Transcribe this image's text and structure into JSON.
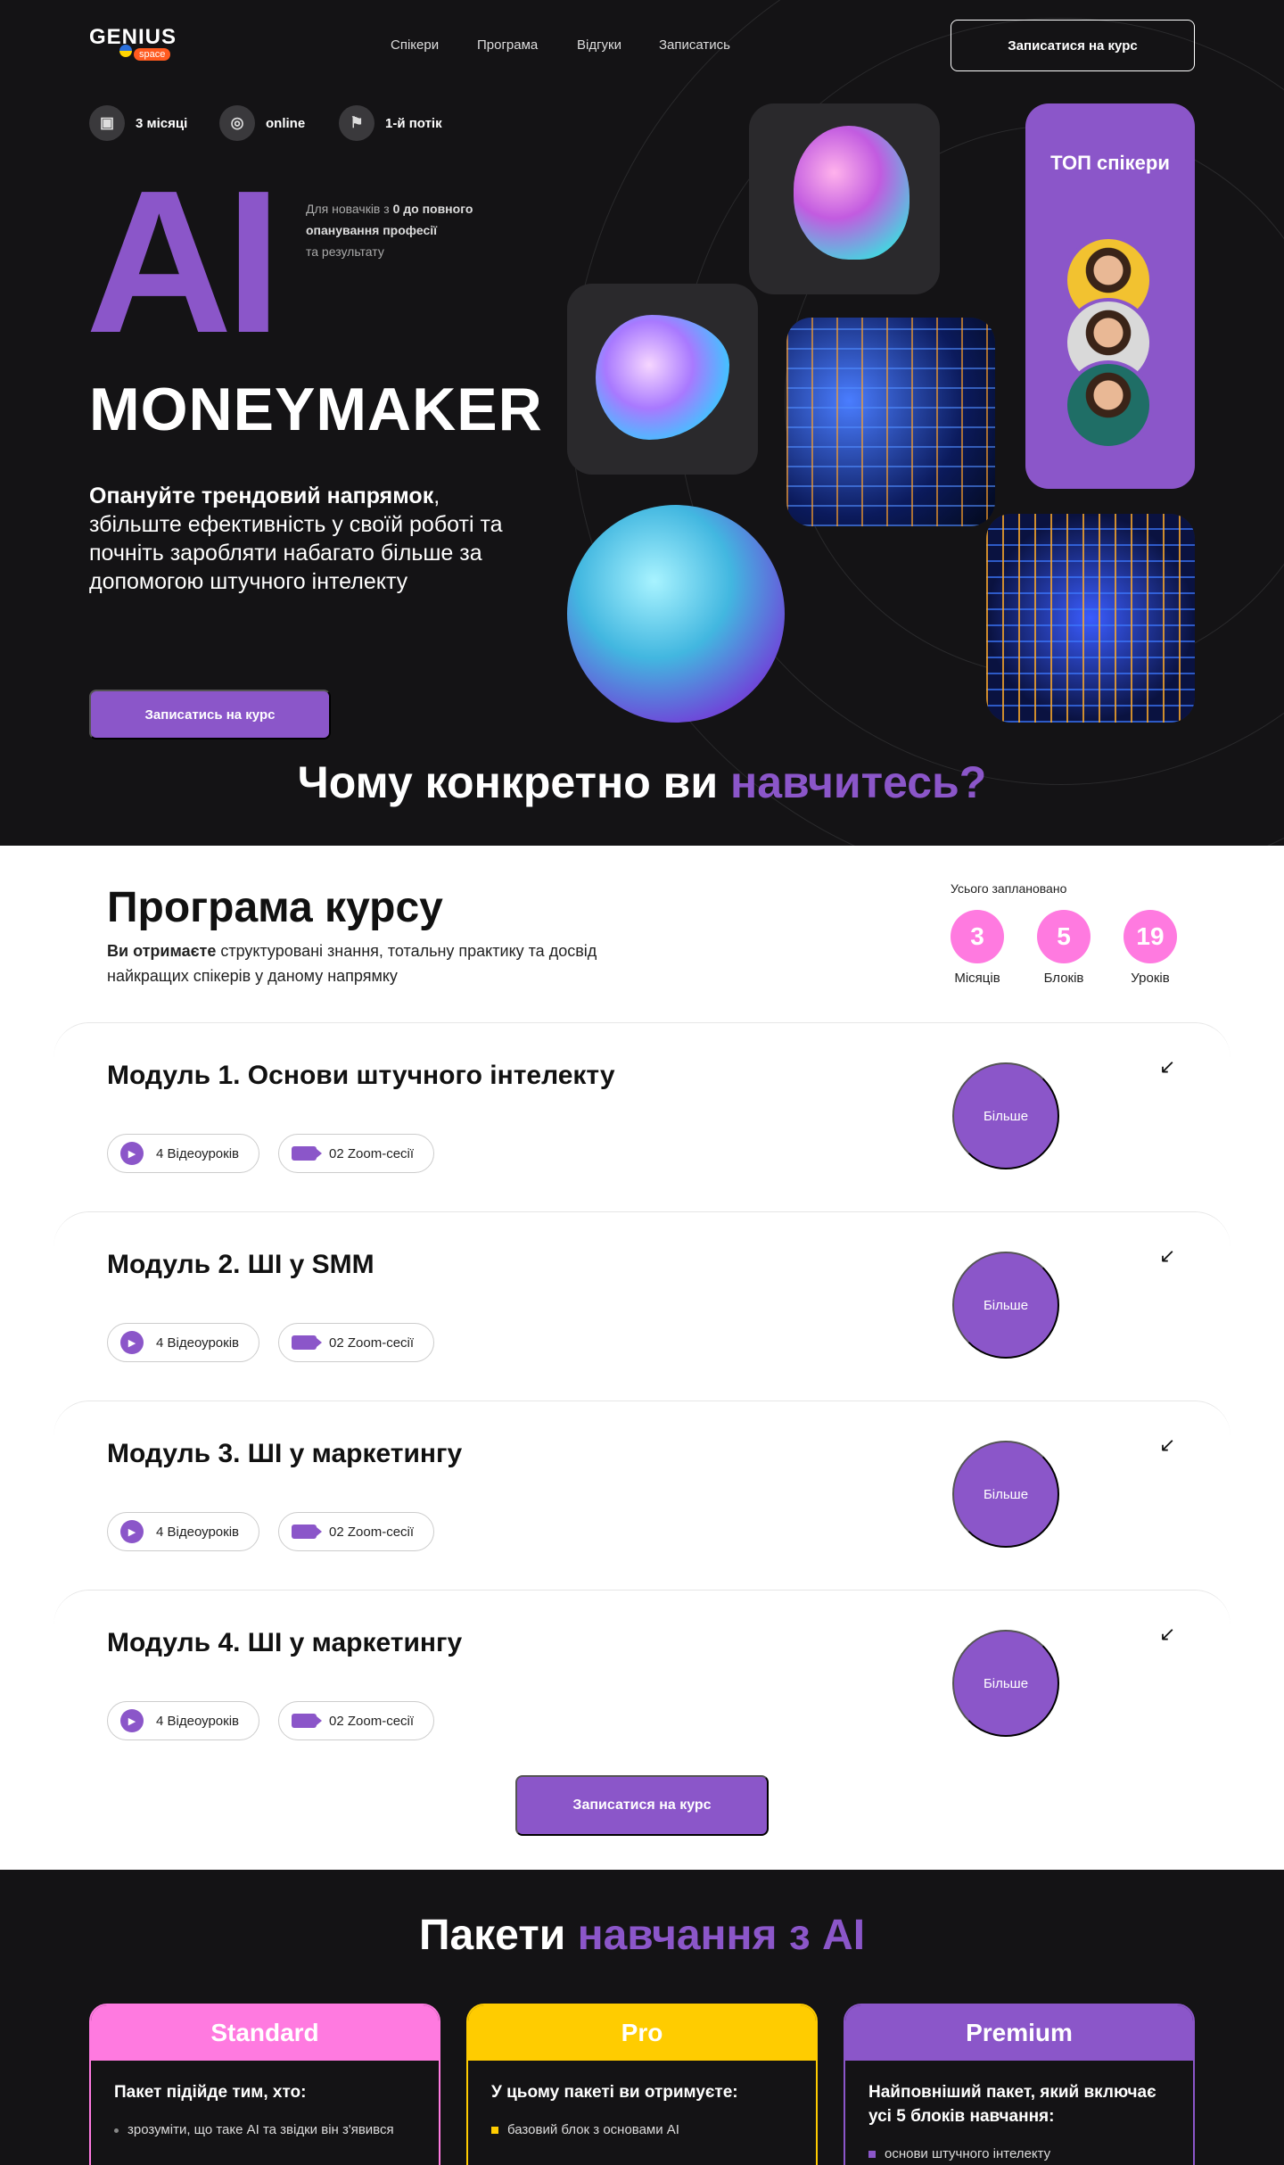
{
  "header": {
    "logo": "GENIUS",
    "logo_sub": "space",
    "nav": [
      "Спікери",
      "Програма",
      "Відгуки",
      "Записатись"
    ],
    "cta": "Записатися на курс"
  },
  "hero": {
    "meta": [
      {
        "icon": "calendar-icon",
        "label": "3 місяці"
      },
      {
        "icon": "globe-icon",
        "label": "online"
      },
      {
        "icon": "flag-icon",
        "label": "1-й потік"
      }
    ],
    "ai": "AI",
    "aside_pre": "Для новачків з ",
    "aside_bold": "0 до повного опанування професії",
    "aside_post": "та результату",
    "title": "MONEYMAKER",
    "desc_bold": "Опануйте трендовий напрямок",
    "desc_rest": ", збільште ефективність у своїй роботі та почніть заробляти набагато більше за допомогою штучного інтелекту",
    "cta": "Записатись на курс",
    "speakers_title": "ТОП спікери",
    "avatar_colors": [
      "#f2c230",
      "#d9d9d9",
      "#1f6e66"
    ]
  },
  "why": {
    "part1": "Чому конкретно ви ",
    "part2": "навчитесь?"
  },
  "program": {
    "title": "Програма курсу",
    "sub_bold": "Ви отримаєте",
    "sub_rest": " структуровані знання, тотальну практику та досвід найкращих спікерів у даному напрямку",
    "planned": "Усього заплановано",
    "stats": [
      {
        "num": "3",
        "label": "Місяців"
      },
      {
        "num": "5",
        "label": "Блоків"
      },
      {
        "num": "19",
        "label": "Уроків"
      }
    ],
    "modules": [
      {
        "title": "Модуль 1. Основи штучного інтелекту",
        "videos": "4 Відеоуроків",
        "zoom": "02 Zoom-сесії",
        "more": "Більше"
      },
      {
        "title": "Модуль 2. ШІ у SMM",
        "videos": "4 Відеоуроків",
        "zoom": "02 Zoom-сесії",
        "more": "Більше"
      },
      {
        "title": "Модуль 3. ШІ у маркетингу",
        "videos": "4 Відеоуроків",
        "zoom": "02 Zoom-сесії",
        "more": "Більше"
      },
      {
        "title": "Модуль 4. ШІ у маркетингу",
        "videos": "4 Відеоуроків",
        "zoom": "02 Zoom-сесії",
        "more": "Більше"
      }
    ],
    "cta": "Записатися на курс"
  },
  "packages": {
    "part1": "Пакети ",
    "part2": "навчання з AI",
    "cards": [
      {
        "name": "Standard",
        "color": "#ff7ae0",
        "lead": "Пакет підійде тим, хто:",
        "item": "зрозуміти, що таке AI та звідки він з'явився",
        "bullet": "#888"
      },
      {
        "name": "Pro",
        "color": "#ffcc00",
        "lead": "У цьому пакеті ви отримуєте:",
        "item": "базовий блок з основами AI",
        "bullet": "#ffcc00"
      },
      {
        "name": "Premium",
        "color": "#8b56c9",
        "lead": "Найповніший пакет, який включає усі 5 блоків навчання:",
        "item": "основи штучного інтелекту",
        "bullet": "#8b56c9"
      }
    ]
  }
}
